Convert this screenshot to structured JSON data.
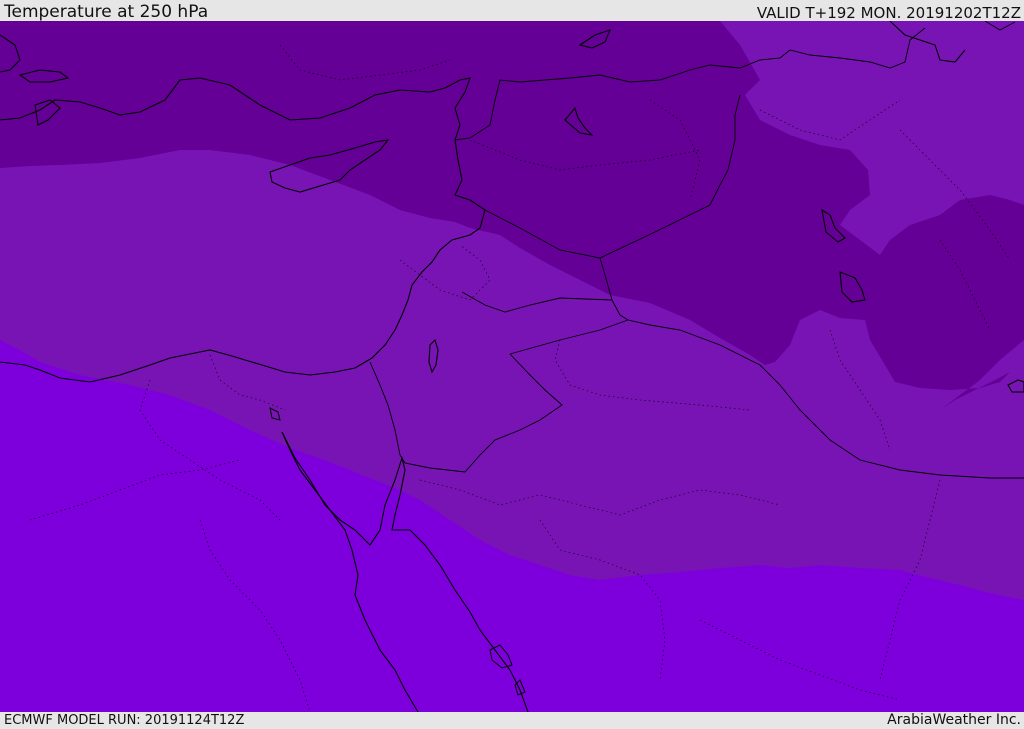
{
  "header": {
    "title": "Temperature at 250 hPa",
    "valid": "VALID T+192 MON. 20191202T12Z"
  },
  "footer": {
    "model_run": "ECMWF MODEL RUN: 20191124T12Z",
    "credit": "ArabiaWeather Inc."
  },
  "palette": {
    "band_cold": "#640096",
    "band_mid": "#7814b4",
    "band_warm": "#7d00dc",
    "coastline": "#000000",
    "border": "#000000"
  }
}
